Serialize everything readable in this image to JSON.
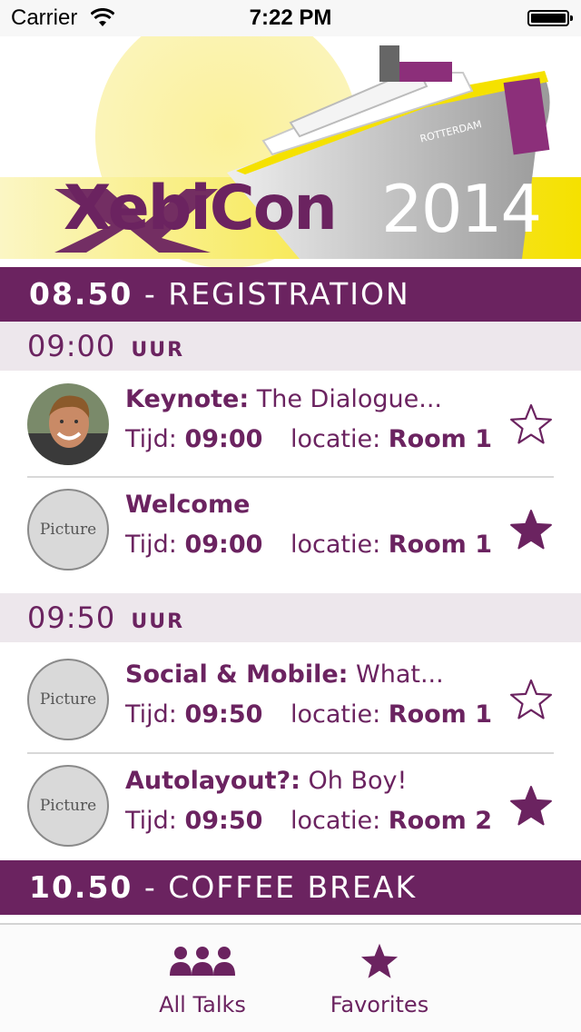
{
  "status_bar": {
    "carrier": "Carrier",
    "time": "7:22 PM"
  },
  "banner": {
    "logo": "XebiCon",
    "year": "2014",
    "ship_name": "ROTTERDAM"
  },
  "sessions": [
    {
      "time": "08.50",
      "separator": " - ",
      "label": "REGISTRATION"
    },
    {
      "time": "10.50",
      "separator": " - ",
      "label": "COFFEE BREAK"
    }
  ],
  "time_groups": [
    {
      "time": "09:00",
      "suffix": "UUR"
    },
    {
      "time": "09:50",
      "suffix": "UUR"
    }
  ],
  "talks": [
    {
      "title_bold": "Keynote:",
      "title_rest": " The Dialogue...",
      "time_label": "Tijd: ",
      "time": "09:00",
      "location_label": "locatie: ",
      "location": "Room 1",
      "avatar": "photo",
      "favorite": false
    },
    {
      "title_bold": "Welcome",
      "title_rest": "",
      "time_label": "Tijd: ",
      "time": "09:00",
      "location_label": "locatie: ",
      "location": "Room 1",
      "avatar": "Picture",
      "favorite": true
    },
    {
      "title_bold": "Social & Mobile:",
      "title_rest": " What...",
      "time_label": "Tijd: ",
      "time": "09:50",
      "location_label": "locatie: ",
      "location": "Room 1",
      "avatar": "Picture",
      "favorite": false
    },
    {
      "title_bold": "Autolayout?:",
      "title_rest": " Oh Boy!",
      "time_label": "Tijd: ",
      "time": "09:50",
      "location_label": "locatie: ",
      "location": "Room 2",
      "avatar": "Picture",
      "favorite": true
    }
  ],
  "tabbar": {
    "tabs": [
      {
        "label": "All Talks",
        "icon": "people-icon"
      },
      {
        "label": "Favorites",
        "icon": "star-icon"
      }
    ]
  },
  "colors": {
    "brand": "#6b2360",
    "header_bg": "#ede7ec",
    "banner_yellow": "#f5e100"
  }
}
